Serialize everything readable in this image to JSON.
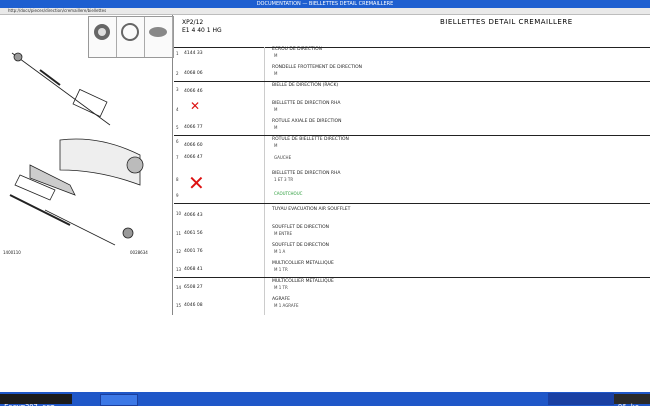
{
  "window": {
    "title": "DOCUMENTATION — BIELLETTES DETAIL CREMAILLERE",
    "address": "http://docs/pieces/direction/cremaillere/biellettes"
  },
  "sheet": {
    "code": "XP2/12",
    "sub": "E1 4 40 1 HG",
    "title": "BIELLETTES DETAIL CREMAILLERE",
    "caption_left": "1400110",
    "caption_right": "0028634"
  },
  "rows": [
    {
      "num": "1",
      "ref": "4144 33",
      "desc": "ECROU DE DIRECTION",
      "sub": "M"
    },
    {
      "num": "2",
      "ref": "4068 06",
      "desc": "RONDELLE FROTTEMENT DE DIRECTION",
      "sub": "M"
    },
    {
      "num": "3",
      "ref": "4066 46",
      "desc": "BIELLE DE DIRECTION (RACK)",
      "sub": ""
    },
    {
      "num": "4",
      "ref": "",
      "desc": "BIELLETTE DE DIRECTION RHA",
      "sub": "M"
    },
    {
      "num": "5",
      "ref": "4066 77",
      "desc": "ROTULE AXIALE DE DIRECTION",
      "sub": "M"
    },
    {
      "num": "6",
      "ref": "4066 60",
      "desc": "ROTULE DE BIELLETTE DIRECTION",
      "sub": "M"
    },
    {
      "num": "7",
      "ref": "4066 47",
      "desc": "",
      "sub": "GAUCHE"
    },
    {
      "num": "8",
      "ref": "",
      "desc": "BIELLETTE DE DIRECTION RHA",
      "sub": "1 ET 3 TR"
    },
    {
      "num": "9",
      "ref": "",
      "desc": "",
      "sub": "CAOUTCHOUC",
      "green": true
    },
    {
      "num": "10",
      "ref": "4066 43",
      "desc": "TUYAU EVACUATION AIR SOUFFLET",
      "sub": ""
    },
    {
      "num": "11",
      "ref": "4061 56",
      "desc": "SOUFFLET DE DIRECTION",
      "sub": "M ENTRE"
    },
    {
      "num": "12",
      "ref": "4001 76",
      "desc": "SOUFFLET DE DIRECTION",
      "sub": "M 1 A"
    },
    {
      "num": "13",
      "ref": "4068 41",
      "desc": "MULTICOLLIER METALLIQUE",
      "sub": "M 1 TR"
    },
    {
      "num": "14",
      "ref": "6508 27",
      "desc": "MULTICOLLIER METALLIQUE",
      "sub": "M 1 TR"
    },
    {
      "num": "15",
      "ref": "4046 08",
      "desc": "AGRAFE",
      "sub": "M 1 AGRAFE"
    }
  ],
  "taskbar": {
    "start_label": "Forum307.com",
    "size_label": "96 ko"
  }
}
